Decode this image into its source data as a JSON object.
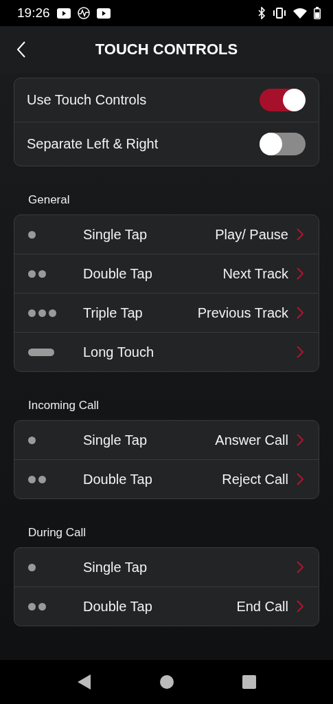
{
  "status_bar": {
    "time": "19:26"
  },
  "header": {
    "title": "TOUCH CONTROLS"
  },
  "toggles": [
    {
      "label": "Use Touch Controls",
      "on": true
    },
    {
      "label": "Separate Left & Right",
      "on": false
    }
  ],
  "sections": [
    {
      "title": "General",
      "rows": [
        {
          "kind": "single",
          "label": "Single Tap",
          "action": "Play/ Pause"
        },
        {
          "kind": "double",
          "label": "Double Tap",
          "action": "Next Track"
        },
        {
          "kind": "triple",
          "label": "Triple Tap",
          "action": "Previous Track"
        },
        {
          "kind": "long",
          "label": "Long Touch"
        }
      ]
    },
    {
      "title": "Incoming Call",
      "rows": [
        {
          "kind": "single",
          "label": "Single Tap",
          "action": "Answer Call"
        },
        {
          "kind": "double",
          "label": "Double Tap",
          "action": "Reject Call"
        }
      ]
    },
    {
      "title": "During Call",
      "rows": [
        {
          "kind": "single",
          "label": "Single Tap"
        },
        {
          "kind": "double",
          "label": "Double Tap",
          "action": "End Call"
        }
      ]
    }
  ]
}
